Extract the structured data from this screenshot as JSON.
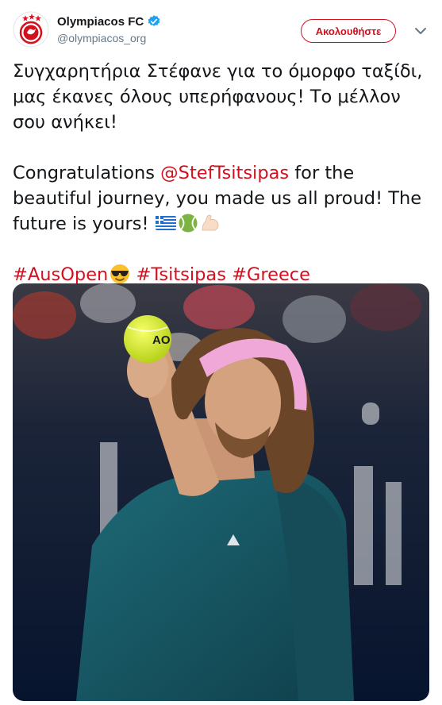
{
  "account": {
    "display_name": "Olympiacos FC",
    "handle": "@olympiacos_org",
    "verified": true,
    "avatar_icon": "olympiacos-crest-icon"
  },
  "actions": {
    "follow_label": "Ακολουθήστε",
    "menu_icon": "chevron-down-icon"
  },
  "tweet": {
    "greek_text": "Συγχαρητήρια Στέφανε για το όμορφο ταξίδι, μας έκανες όλους υπερήφανους! Το μέλλον σου ανήκει!",
    "english_prefix": "Congratulations ",
    "mention": "@StefTsitsipas",
    "english_suffix": " for the beautiful journey, you made us all proud! The future is yours!",
    "emojis": [
      "greece-flag-icon",
      "tennis-ball-icon",
      "flexed-biceps-icon"
    ],
    "hashtags": [
      "#AusOpen",
      "#Tsitsipas",
      "#Greece"
    ],
    "hashtag_emoji": "sunglasses-face-icon"
  },
  "media": {
    "alt": "Tennis player tossing a ball to serve",
    "ball_text": "AO"
  },
  "colors": {
    "accent": "#d4101f",
    "verified": "#1da1f2",
    "text": "#14171a",
    "secondary": "#657786"
  }
}
